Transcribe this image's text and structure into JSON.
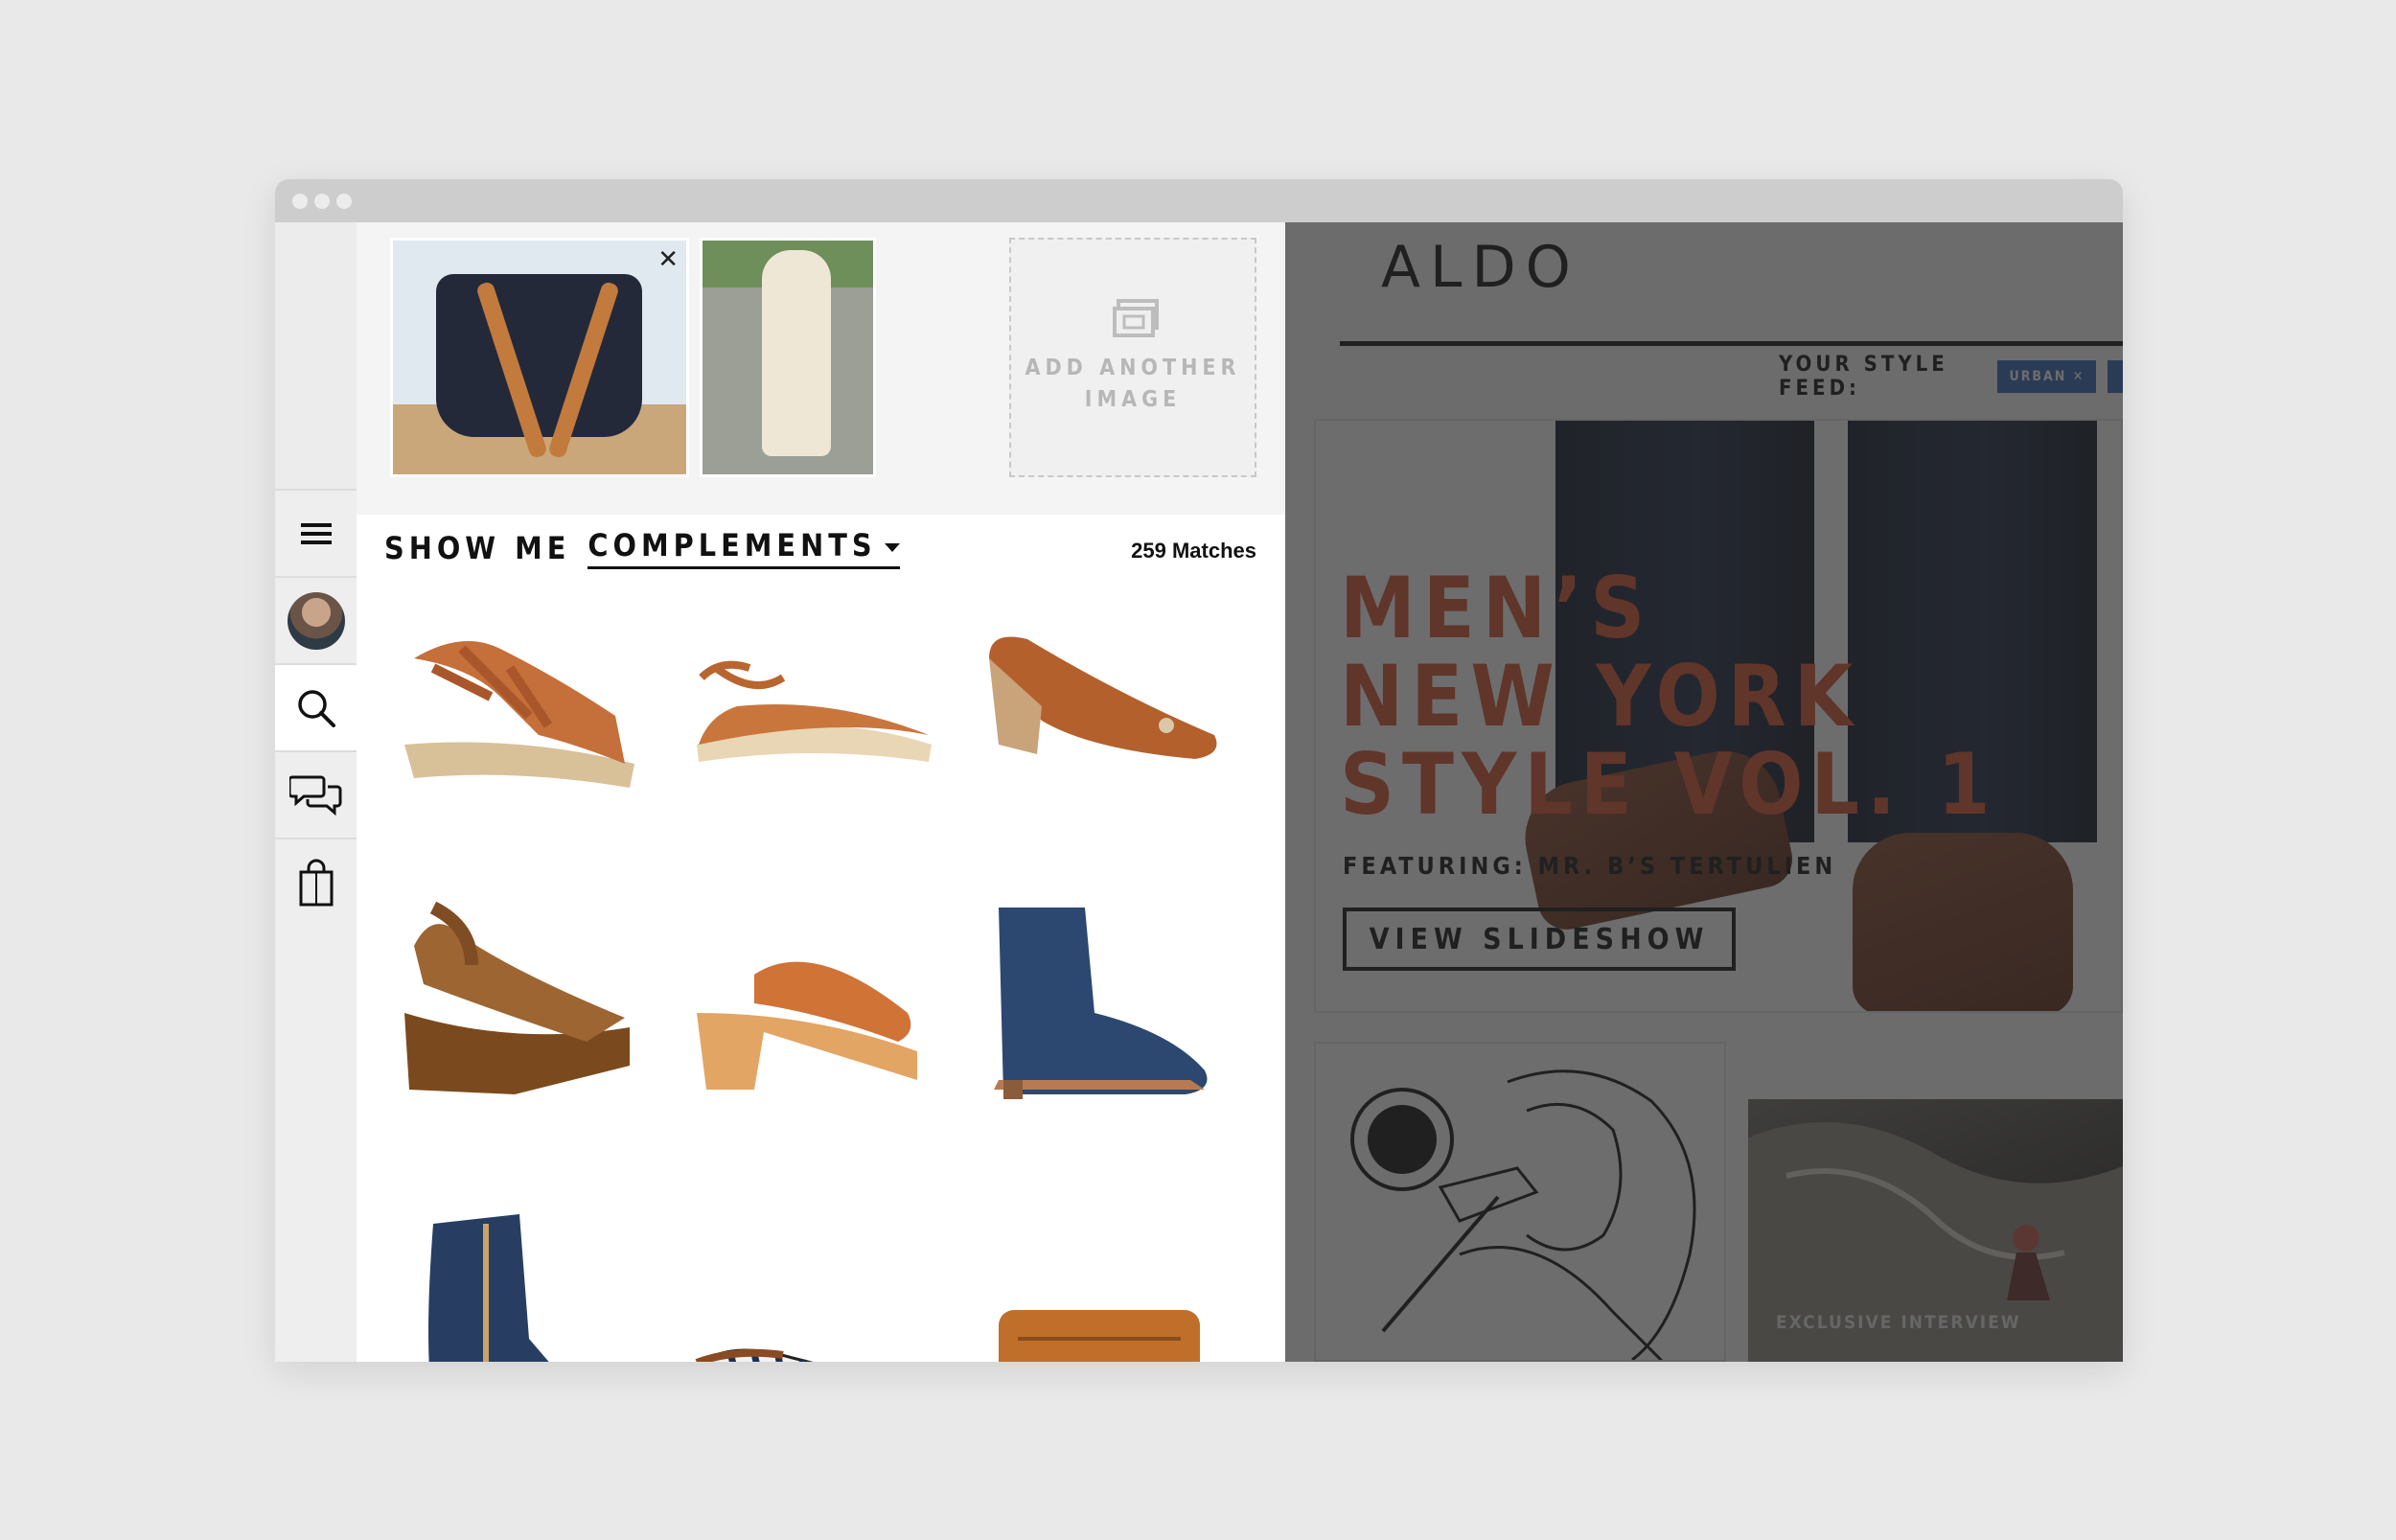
{
  "window": {
    "dots": [
      "",
      "",
      ""
    ]
  },
  "sidebar": {
    "items": [
      {
        "icon": "hamburger-menu-icon"
      },
      {
        "icon": "user-avatar"
      },
      {
        "icon": "search-icon"
      },
      {
        "icon": "chat-bubbles-icon"
      },
      {
        "icon": "shopping-bag-icon"
      }
    ]
  },
  "uploads": {
    "add_label": "ADD ANOTHER\nIMAGE"
  },
  "filter": {
    "prefix": "SHOW ME",
    "selected": "COMPLEMENTS",
    "matches": "259 Matches"
  },
  "products": [
    "wedge-sandal",
    "ankle-strap-espadrille-flat",
    "wedge-pump",
    "platform-wedge-sandal",
    "clog-mule",
    "suede-ankle-bootie",
    "navy-ankle-boot",
    "striped-slip-on",
    "leather-wallet"
  ],
  "feed": {
    "brand": "ALDO",
    "style_feed_label": "YOUR STYLE FEED:",
    "tag": "URBAN",
    "hero_title": "MEN’S\nNEW YORK\nSTYLE VOL. 1",
    "featuring": "FEATURING: MR. B’S TERTULIEN",
    "cta": "VIEW SLIDESHOW",
    "card_caption": "EXCLUSIVE INTERVIEW"
  },
  "colors": {
    "accent_tag": "#2f63b4",
    "hero_title": "#d7512f",
    "overlay": "#282828"
  }
}
